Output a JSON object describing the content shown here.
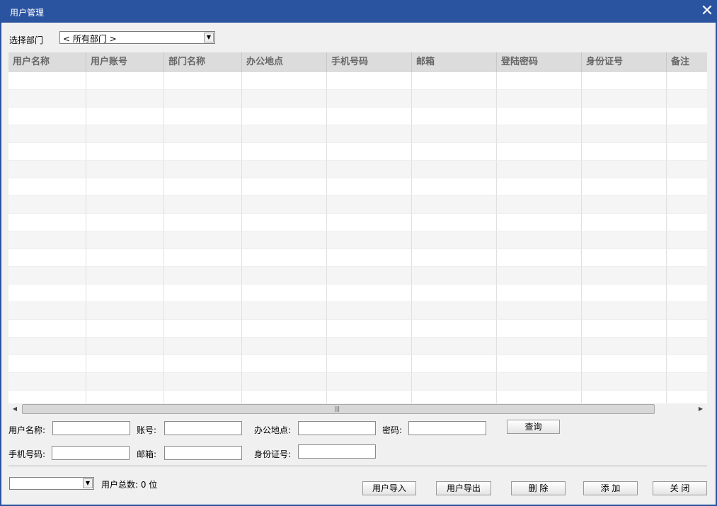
{
  "window": {
    "title": "用户管理",
    "close_glyph": "✕"
  },
  "filter": {
    "dept_label": "选择部门",
    "dept_value": "< 所有部门 >"
  },
  "table": {
    "columns": [
      "用户名称",
      "用户账号",
      "部门名称",
      "办公地点",
      "手机号码",
      "邮箱",
      "登陆密码",
      "身份证号",
      "备注"
    ],
    "rows": []
  },
  "search": {
    "name_label": "用户名称:",
    "account_label": "账号:",
    "office_label": "办公地点:",
    "password_label": "密码:",
    "query_button": "查询",
    "phone_label": "手机号码:",
    "email_label": "邮箱:",
    "id_label": "身份证号:"
  },
  "footer": {
    "page_select_value": "",
    "total_text": "用户总数: 0 位",
    "import_button": "用户导入",
    "export_button": "用户导出",
    "delete_button": "删 除",
    "add_button": "添 加",
    "close_button": "关 闭"
  },
  "icons": {
    "dropdown": "chevron-down-icon",
    "scroll_left": "arrow-left-icon",
    "scroll_right": "arrow-right-icon"
  },
  "colors": {
    "titlebar": "#2a53a0",
    "client": "#f0f0f0",
    "header": "#dcdcdc"
  }
}
